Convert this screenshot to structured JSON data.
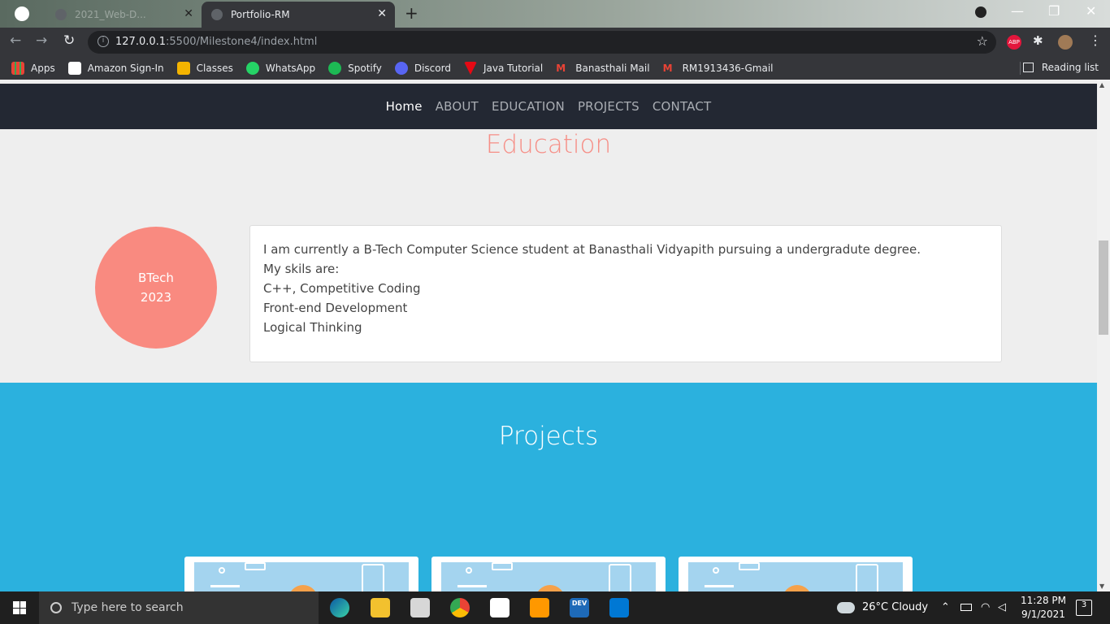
{
  "browser": {
    "tabs": [
      {
        "label": "2021_Web-D...",
        "close": "✕"
      },
      {
        "label": "Portfolio-RM",
        "close": "✕"
      }
    ],
    "new_tab": "+",
    "window_controls": {
      "minimize": "—",
      "restore": "❐",
      "close": "✕"
    },
    "url_host": "127.0.0.1",
    "url_rest": ":5500/Milestone4/index.html",
    "bookmarks": [
      {
        "label": "Apps",
        "color": "#ea4335"
      },
      {
        "label": "Amazon Sign-In",
        "color": "#ffffff"
      },
      {
        "label": "Classes",
        "color": "#f4b400"
      },
      {
        "label": "WhatsApp",
        "color": "#25d366"
      },
      {
        "label": "Spotify",
        "color": "#1db954"
      },
      {
        "label": "Discord",
        "color": "#5865f2"
      },
      {
        "label": "Java Tutorial",
        "color": "#e50914"
      },
      {
        "label": "Banasthali Mail",
        "color": "#ea4335"
      },
      {
        "label": "RM1913436-Gmail",
        "color": "#ea4335"
      }
    ],
    "reading_list": "Reading list",
    "ext_abp": "ABP"
  },
  "page": {
    "nav": [
      "Home",
      "ABOUT",
      "EDUCATION",
      "PROJECTS",
      "CONTACT"
    ],
    "education": {
      "title": "Education",
      "degree": "BTech",
      "year": "2023",
      "lines": [
        "I am currently a B-Tech Computer Science student at Banasthali Vidyapith pursuing a undergradute degree.",
        "My skils are:",
        "C++, Competitive Coding",
        "Front-end Development",
        "Logical Thinking"
      ]
    },
    "projects": {
      "title": "Projects"
    }
  },
  "taskbar": {
    "search_placeholder": "Type here to search",
    "weather": "26°C  Cloudy",
    "time": "11:28 PM",
    "date": "9/1/2021",
    "notifications": "3",
    "dev_label": "DEV"
  }
}
